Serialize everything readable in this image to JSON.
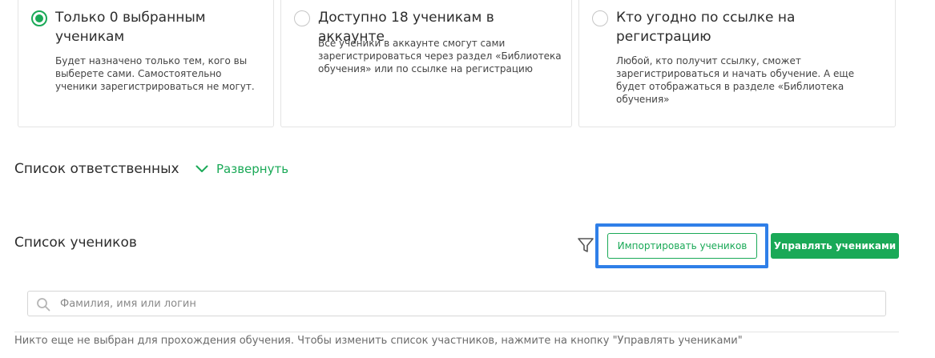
{
  "colors": {
    "accent": "#1aa957",
    "highlight": "#2f7fe8",
    "border": "#e4e4e4"
  },
  "access_options": [
    {
      "title": "Только 0 выбранным ученикам",
      "description": "Будет назначено только тем, кого вы выберете сами. Самостоятельно ученики зарегистрироваться не могут.",
      "selected": true
    },
    {
      "title": "Доступно 18 ученикам в аккаунте",
      "description": "Все ученики в аккаунте смогут сами зарегистрироваться через раздел «Библиотека обучения» или по ссылке на регистрацию",
      "selected": false
    },
    {
      "title": "Кто угодно по ссылке на регистрацию",
      "description": "Любой, кто получит ссылку, сможет зарегистрироваться и начать обучение. А еще будет отображаться в разделе «Библиотека обучения»",
      "selected": false
    }
  ],
  "responsibles": {
    "title": "Список ответственных",
    "expand_label": "Развернуть",
    "expand_icon": "chevron-down-icon"
  },
  "students": {
    "title": "Список учеников",
    "filter_icon": "filter-icon",
    "import_label": "Импортировать учеников",
    "manage_label": "Управлять учениками",
    "search": {
      "placeholder": "Фамилия, имя или логин",
      "value": "",
      "icon": "search-icon"
    },
    "empty_note": "Никто еще не выбран для прохождения обучения. Чтобы изменить список участников, нажмите на кнопку \"Управлять учениками\""
  }
}
